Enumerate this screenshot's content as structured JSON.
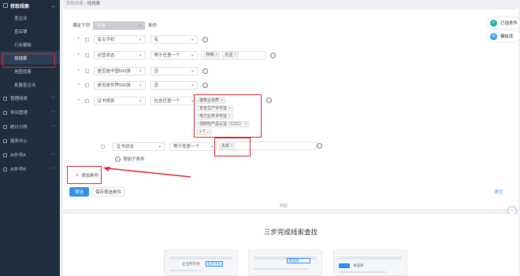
{
  "sidebar": {
    "group_title": "获取线索",
    "sub_items": [
      {
        "label": "查企业"
      },
      {
        "label": "查店铺"
      },
      {
        "label": "行业模板"
      },
      {
        "label": "找线索"
      },
      {
        "label": "地图找客"
      },
      {
        "label": "批量查企业"
      }
    ],
    "items": [
      {
        "label": "管理线索"
      },
      {
        "label": "导出管理"
      },
      {
        "label": "统计分析"
      },
      {
        "label": "服务中心"
      },
      {
        "label": "AI外呼A"
      },
      {
        "label": "AI外呼B"
      }
    ]
  },
  "breadcrumb": {
    "parent": "获取线索",
    "sep": "/",
    "current": "找线索"
  },
  "filter": {
    "match_label": "满足下列",
    "match_value": "所有",
    "cond_suffix": "条件:",
    "rows": [
      {
        "field": "有无手机",
        "value": "有"
      },
      {
        "field": "经营状态",
        "op": "等于任意一个",
        "tags": [
          "存续",
          "在业"
        ]
      },
      {
        "field": "是否是中国500强",
        "value": "否"
      },
      {
        "field": "是否是世界500强",
        "value": "否"
      },
      {
        "field": "证书类别",
        "op": "包含任意一个",
        "tags": [
          "建筑业资质",
          "安全生产许可证",
          "电力业务许可证",
          "强制性产品认证（CCC）"
        ],
        "more": "+ 7 ..."
      }
    ],
    "sub_row": {
      "field": "证书状态",
      "op": "等于任意一个",
      "tags": [
        "失效"
      ]
    },
    "add_sub": "添加子条件",
    "add_condition": "添加条件",
    "btn_filter": "筛选",
    "btn_save": "保存筛选条件",
    "btn_clear": "清空",
    "collapse": "收起"
  },
  "float_buttons": [
    {
      "label": "已选条件",
      "icon": "filter-icon"
    },
    {
      "label": "模板库",
      "icon": "template-icon"
    }
  ],
  "bottom": {
    "title": "三步完成线索查找",
    "thumb1_text1": "企业所在地",
    "thumb1_text2": "有无手机",
    "thumb2_text": "请选择",
    "thumb3_text": "请选择"
  },
  "colors": {
    "sidebar_bg": "#1f2d3d",
    "accent": "#2f8ff0",
    "highlight": "#d9262c"
  }
}
